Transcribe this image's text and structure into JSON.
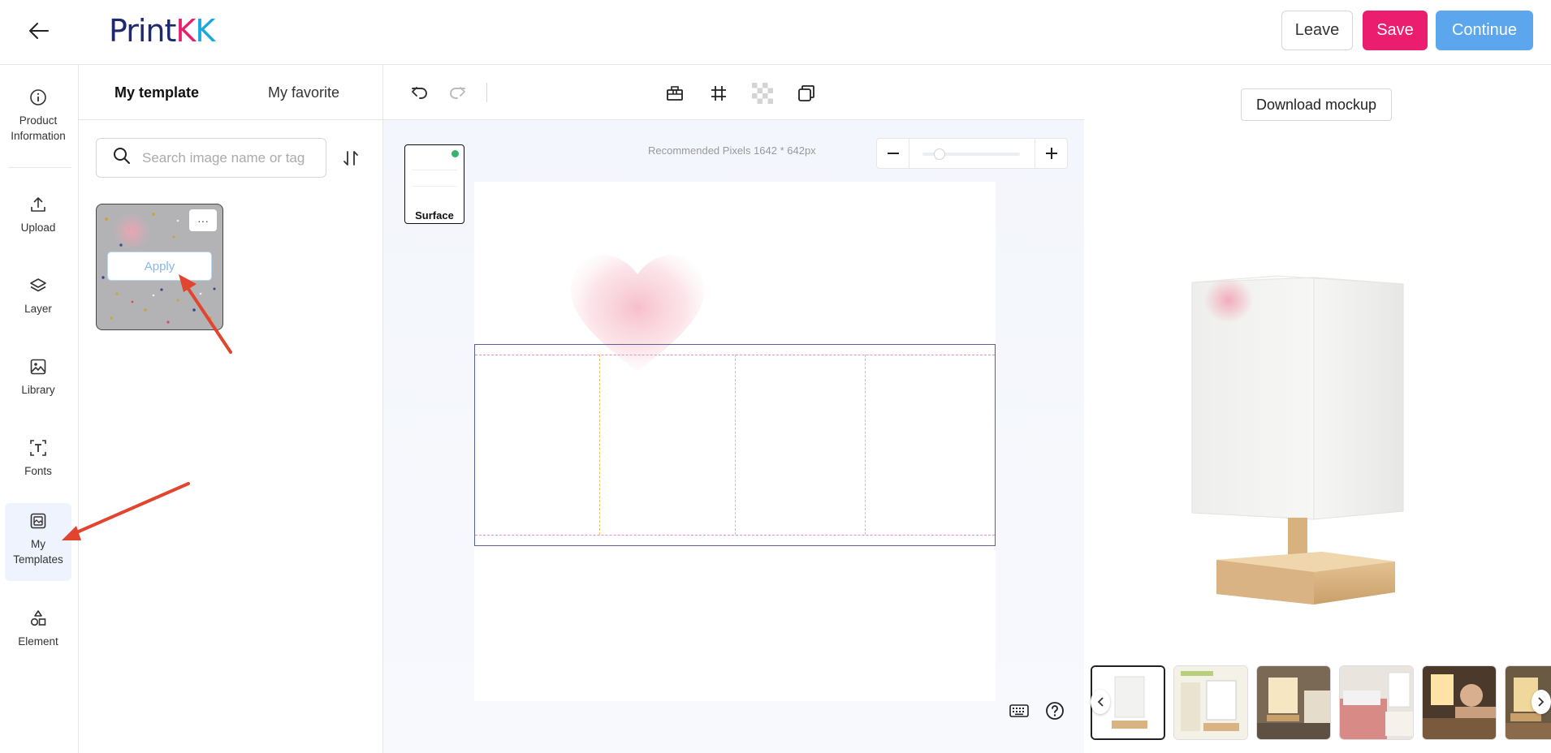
{
  "header": {
    "logo_main": "Print",
    "logo_k1": "K",
    "logo_k2": "K",
    "leave_label": "Leave",
    "save_label": "Save",
    "continue_label": "Continue"
  },
  "rail": {
    "items": [
      {
        "label": "Product Information",
        "icon": "info-icon"
      },
      {
        "label": "Upload",
        "icon": "upload-icon"
      },
      {
        "label": "Layer",
        "icon": "layers-icon"
      },
      {
        "label": "Library",
        "icon": "image-icon"
      },
      {
        "label": "Fonts",
        "icon": "text-icon"
      },
      {
        "label": "My Templates",
        "icon": "template-icon"
      },
      {
        "label": "Element",
        "icon": "shapes-icon"
      }
    ],
    "active": "My Templates"
  },
  "panel": {
    "tab_template": "My template",
    "tab_favorite": "My favorite",
    "search_placeholder": "Search image name or tag",
    "template_more": "···",
    "template_apply": "Apply"
  },
  "toolbar": {
    "icons": [
      "undo-icon",
      "redo-icon",
      "align-icon",
      "grid-icon",
      "transparency-icon",
      "duplicate-icon"
    ]
  },
  "canvas": {
    "surface_label": "Surface",
    "recommended_pixels": "Recommended Pixels 1642 * 642px",
    "zoom_level": 0.1
  },
  "preview": {
    "download_label": "Download mockup",
    "thumbnail_count": 6,
    "selected_thumbnail": 0
  },
  "colors": {
    "brand_pink": "#ea1d6f",
    "brand_blue": "#5ba6ec",
    "brand_navy": "#1e2a6e",
    "annotation_red": "#e2452f"
  }
}
